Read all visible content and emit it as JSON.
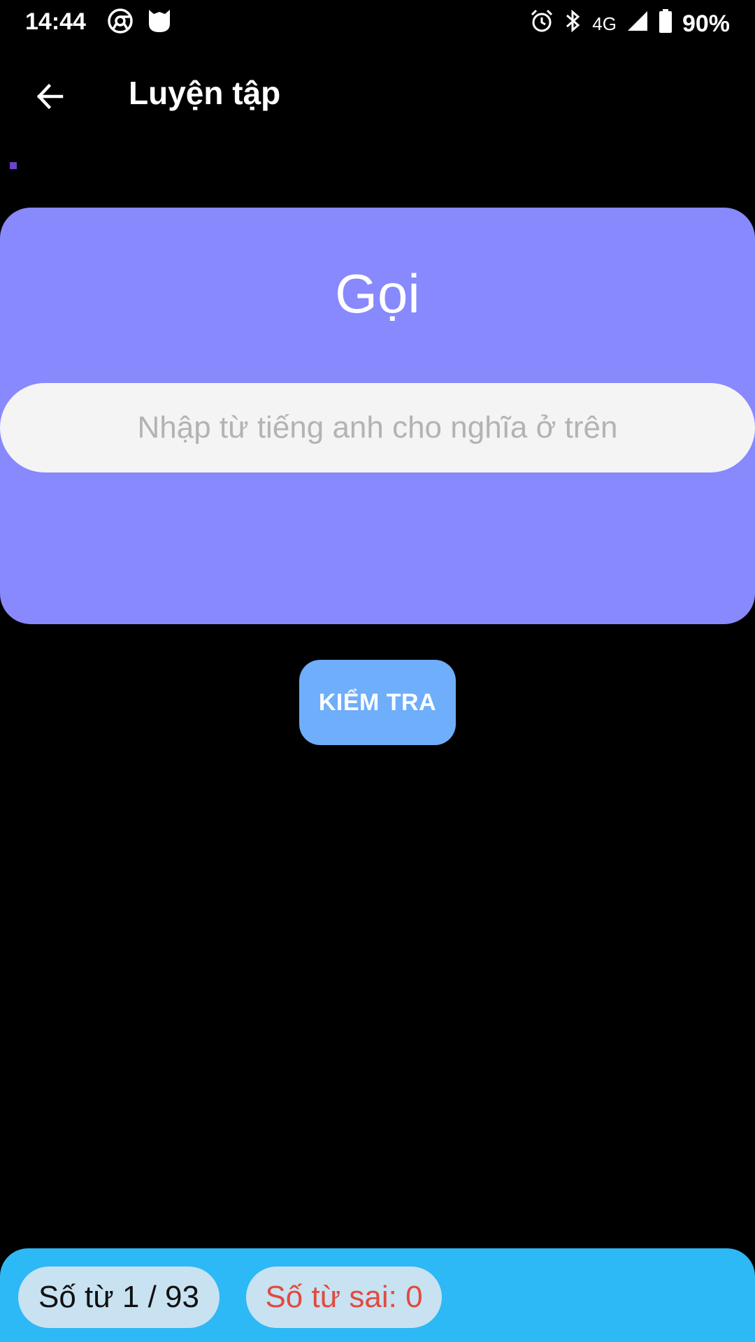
{
  "status_bar": {
    "time": "14:44",
    "network": "4G",
    "battery": "90%",
    "icons": [
      "chrome-icon",
      "app-icon",
      "alarm-icon",
      "bluetooth-icon",
      "signal-icon",
      "battery-icon"
    ]
  },
  "app_bar": {
    "title": "Luyện tập",
    "back_icon": "arrow-back-icon"
  },
  "card": {
    "word": "Gọi",
    "input_value": "",
    "input_placeholder": "Nhập từ tiếng anh cho nghĩa ở trên"
  },
  "check_button": {
    "label": "KIỂM TRA"
  },
  "bottom_bar": {
    "word_count": "Số từ 1 / 93",
    "wrong_count": "Số từ sai: 0"
  },
  "colors": {
    "background": "#000000",
    "card": "#8789fd",
    "check_button": "#6eaefa",
    "bottom_bar": "#2db8f6",
    "pill": "#c8e2f1",
    "wrong_text": "#e24a3f"
  }
}
